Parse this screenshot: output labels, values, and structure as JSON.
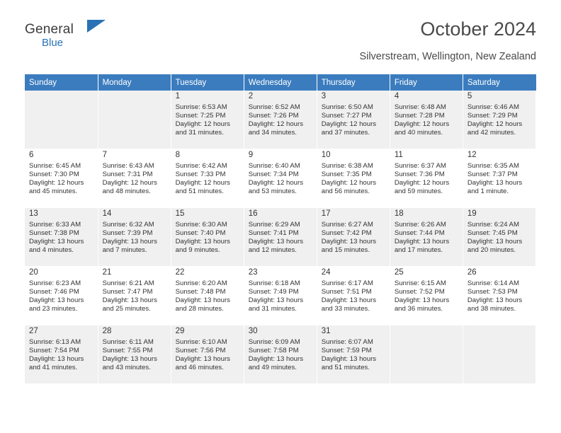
{
  "brand": {
    "word1": "General",
    "word2": "Blue"
  },
  "header": {
    "title": "October 2024",
    "subtitle": "Silverstream, Wellington, New Zealand"
  },
  "calendar": {
    "weekday_headers": [
      "Sunday",
      "Monday",
      "Tuesday",
      "Wednesday",
      "Thursday",
      "Friday",
      "Saturday"
    ],
    "accent_color": "#3b7cbf",
    "shaded_row_color": "#f0f0f0",
    "weeks": [
      [
        {
          "day": "",
          "info": ""
        },
        {
          "day": "",
          "info": ""
        },
        {
          "day": "1",
          "info": "Sunrise: 6:53 AM\nSunset: 7:25 PM\nDaylight: 12 hours\nand 31 minutes."
        },
        {
          "day": "2",
          "info": "Sunrise: 6:52 AM\nSunset: 7:26 PM\nDaylight: 12 hours\nand 34 minutes."
        },
        {
          "day": "3",
          "info": "Sunrise: 6:50 AM\nSunset: 7:27 PM\nDaylight: 12 hours\nand 37 minutes."
        },
        {
          "day": "4",
          "info": "Sunrise: 6:48 AM\nSunset: 7:28 PM\nDaylight: 12 hours\nand 40 minutes."
        },
        {
          "day": "5",
          "info": "Sunrise: 6:46 AM\nSunset: 7:29 PM\nDaylight: 12 hours\nand 42 minutes."
        }
      ],
      [
        {
          "day": "6",
          "info": "Sunrise: 6:45 AM\nSunset: 7:30 PM\nDaylight: 12 hours\nand 45 minutes."
        },
        {
          "day": "7",
          "info": "Sunrise: 6:43 AM\nSunset: 7:31 PM\nDaylight: 12 hours\nand 48 minutes."
        },
        {
          "day": "8",
          "info": "Sunrise: 6:42 AM\nSunset: 7:33 PM\nDaylight: 12 hours\nand 51 minutes."
        },
        {
          "day": "9",
          "info": "Sunrise: 6:40 AM\nSunset: 7:34 PM\nDaylight: 12 hours\nand 53 minutes."
        },
        {
          "day": "10",
          "info": "Sunrise: 6:38 AM\nSunset: 7:35 PM\nDaylight: 12 hours\nand 56 minutes."
        },
        {
          "day": "11",
          "info": "Sunrise: 6:37 AM\nSunset: 7:36 PM\nDaylight: 12 hours\nand 59 minutes."
        },
        {
          "day": "12",
          "info": "Sunrise: 6:35 AM\nSunset: 7:37 PM\nDaylight: 13 hours\nand 1 minute."
        }
      ],
      [
        {
          "day": "13",
          "info": "Sunrise: 6:33 AM\nSunset: 7:38 PM\nDaylight: 13 hours\nand 4 minutes."
        },
        {
          "day": "14",
          "info": "Sunrise: 6:32 AM\nSunset: 7:39 PM\nDaylight: 13 hours\nand 7 minutes."
        },
        {
          "day": "15",
          "info": "Sunrise: 6:30 AM\nSunset: 7:40 PM\nDaylight: 13 hours\nand 9 minutes."
        },
        {
          "day": "16",
          "info": "Sunrise: 6:29 AM\nSunset: 7:41 PM\nDaylight: 13 hours\nand 12 minutes."
        },
        {
          "day": "17",
          "info": "Sunrise: 6:27 AM\nSunset: 7:42 PM\nDaylight: 13 hours\nand 15 minutes."
        },
        {
          "day": "18",
          "info": "Sunrise: 6:26 AM\nSunset: 7:44 PM\nDaylight: 13 hours\nand 17 minutes."
        },
        {
          "day": "19",
          "info": "Sunrise: 6:24 AM\nSunset: 7:45 PM\nDaylight: 13 hours\nand 20 minutes."
        }
      ],
      [
        {
          "day": "20",
          "info": "Sunrise: 6:23 AM\nSunset: 7:46 PM\nDaylight: 13 hours\nand 23 minutes."
        },
        {
          "day": "21",
          "info": "Sunrise: 6:21 AM\nSunset: 7:47 PM\nDaylight: 13 hours\nand 25 minutes."
        },
        {
          "day": "22",
          "info": "Sunrise: 6:20 AM\nSunset: 7:48 PM\nDaylight: 13 hours\nand 28 minutes."
        },
        {
          "day": "23",
          "info": "Sunrise: 6:18 AM\nSunset: 7:49 PM\nDaylight: 13 hours\nand 31 minutes."
        },
        {
          "day": "24",
          "info": "Sunrise: 6:17 AM\nSunset: 7:51 PM\nDaylight: 13 hours\nand 33 minutes."
        },
        {
          "day": "25",
          "info": "Sunrise: 6:15 AM\nSunset: 7:52 PM\nDaylight: 13 hours\nand 36 minutes."
        },
        {
          "day": "26",
          "info": "Sunrise: 6:14 AM\nSunset: 7:53 PM\nDaylight: 13 hours\nand 38 minutes."
        }
      ],
      [
        {
          "day": "27",
          "info": "Sunrise: 6:13 AM\nSunset: 7:54 PM\nDaylight: 13 hours\nand 41 minutes."
        },
        {
          "day": "28",
          "info": "Sunrise: 6:11 AM\nSunset: 7:55 PM\nDaylight: 13 hours\nand 43 minutes."
        },
        {
          "day": "29",
          "info": "Sunrise: 6:10 AM\nSunset: 7:56 PM\nDaylight: 13 hours\nand 46 minutes."
        },
        {
          "day": "30",
          "info": "Sunrise: 6:09 AM\nSunset: 7:58 PM\nDaylight: 13 hours\nand 49 minutes."
        },
        {
          "day": "31",
          "info": "Sunrise: 6:07 AM\nSunset: 7:59 PM\nDaylight: 13 hours\nand 51 minutes."
        },
        {
          "day": "",
          "info": ""
        },
        {
          "day": "",
          "info": ""
        }
      ]
    ]
  }
}
